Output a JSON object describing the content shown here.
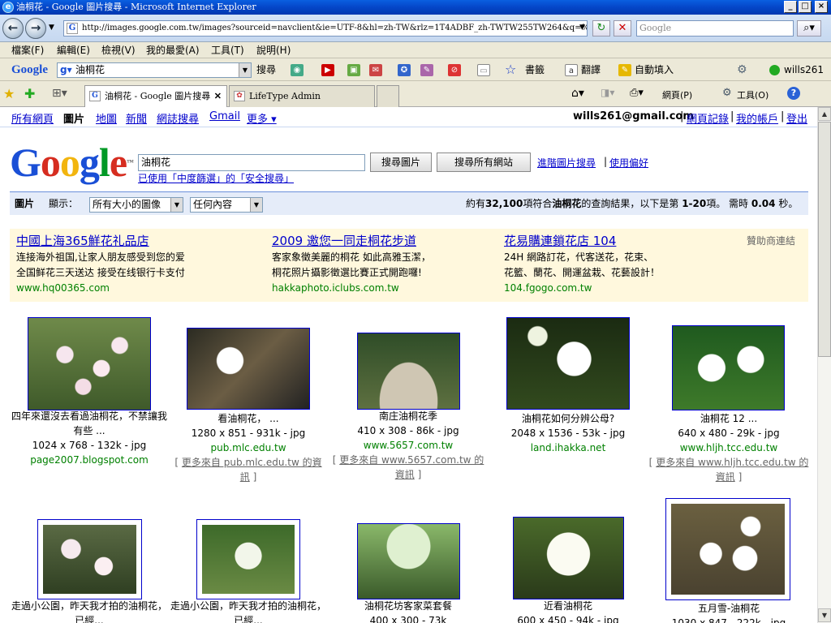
{
  "window": {
    "title": "油桐花 - Google 圖片搜尋 - Microsoft Internet Explorer"
  },
  "address": {
    "url": "http://images.google.com.tw/images?sourceid=navclient&ie=UTF-8&hl=zh-TW&rlz=1T4ADBF_zh-TWTW255TW264&q=%e6%",
    "search_placeholder": "Google"
  },
  "menu": [
    "檔案(F)",
    "編輯(E)",
    "檢視(V)",
    "我的最愛(A)",
    "工具(T)",
    "說明(H)"
  ],
  "gtoolbar": {
    "logo": "Google",
    "query": "油桐花",
    "search": "搜尋",
    "bookmarks": "書籤",
    "translate": "翻譯",
    "autofill": "自動填入",
    "account": "wills261"
  },
  "tabs": [
    {
      "label": "油桐花 - Google 圖片搜尋"
    },
    {
      "label": "LifeType Admin"
    }
  ],
  "ie_cmd": {
    "page": "網頁(P)",
    "tools": "工具(O)"
  },
  "gbar": {
    "links": [
      "所有網頁",
      "圖片",
      "地圖",
      "新聞",
      "網誌搜尋",
      "Gmail",
      "更多 ▾"
    ],
    "email": "wills261@gmail.com",
    "history": "網頁記錄",
    "account": "我的帳戶",
    "logout": "登出"
  },
  "search": {
    "query": "油桐花",
    "btn_images": "搜尋圖片",
    "btn_web": "搜尋所有網站",
    "advanced": "進階圖片搜尋",
    "prefs": "使用偏好",
    "safe": "已使用「中度篩選」的「安全搜尋」"
  },
  "stats": {
    "label": "圖片",
    "show": "顯示：",
    "size": "所有大小的圖像",
    "type": "任何內容",
    "prefix": "約有",
    "count": "32,100",
    "mid": "項符合",
    "term": "油桐花",
    "suffix": "的查詢結果，以下是第",
    "range": "1-20",
    "suffix2": "項。 需時",
    "time": "0.04",
    "suffix3": "秒。"
  },
  "ads_label": "贊助商連結",
  "ads": [
    {
      "title": "中國上海365鮮花礼品店",
      "line1": "连接海外祖国,让家人朋友感受到您的爱",
      "line2": "全国鲜花三天送达 接受在线银行卡支付",
      "url": "www.hq00365.com"
    },
    {
      "title": "2009 邀您一同走桐花步道",
      "line1": "客家象徵美麗的桐花 如此高雅玉潔，",
      "line2": "桐花照片攝影徵選比賽正式開跑囉!",
      "url": "hakkaphoto.iclubs.com.tw"
    },
    {
      "title": "花易購連鎖花店 104",
      "line1": "24H 網路訂花，代客送花，花束、",
      "line2": "花籃、蘭花、開運盆栽、花藝設計！",
      "url": "104.fgogo.com.tw"
    }
  ],
  "results_row1": [
    {
      "title": "四年來還沒去看過油桐花，不禁讓我有些 ...",
      "meta": "1024 x 768 - 132k - jpg",
      "site": "page2007.blogspot.com",
      "more": ""
    },
    {
      "title": "看油桐花， ...",
      "meta": "1280 x 851 - 931k - jpg",
      "site": "pub.mlc.edu.tw",
      "more": "更多來自 pub.mlc.edu.tw 的資訊"
    },
    {
      "title": "南庄油桐花季",
      "meta": "410 x 308 - 86k - jpg",
      "site": "www.5657.com.tw",
      "more": "更多來自 www.5657.com.tw 的資訊"
    },
    {
      "title": "油桐花如何分辨公母?",
      "meta": "2048 x 1536 - 53k - jpg",
      "site": "land.ihakka.net",
      "more": ""
    },
    {
      "title": "油桐花 12 ...",
      "meta": "640 x 480 - 29k - jpg",
      "site": "www.hljh.tcc.edu.tw",
      "more": "更多來自 www.hljh.tcc.edu.tw 的資訊"
    }
  ],
  "results_row2": [
    {
      "title": "走過小公園，昨天我才拍的油桐花，已經..."
    },
    {
      "title": "走過小公園，昨天我才拍的油桐花，已經..."
    },
    {
      "title": "油桐花坊客家菜套餐",
      "meta": "400 x 300 - 73k"
    },
    {
      "title": "近看油桐花",
      "meta": "600 x 450 - 94k - jpg"
    },
    {
      "title": "五月雪-油桐花",
      "meta": "1030 x 847 - 222k - jpg"
    }
  ],
  "colors": {
    "titlebar": "#0546c8",
    "link": "#0000cc",
    "green": "#008000",
    "adbg": "#fff8dd",
    "statsbg": "#e5ecf9"
  }
}
